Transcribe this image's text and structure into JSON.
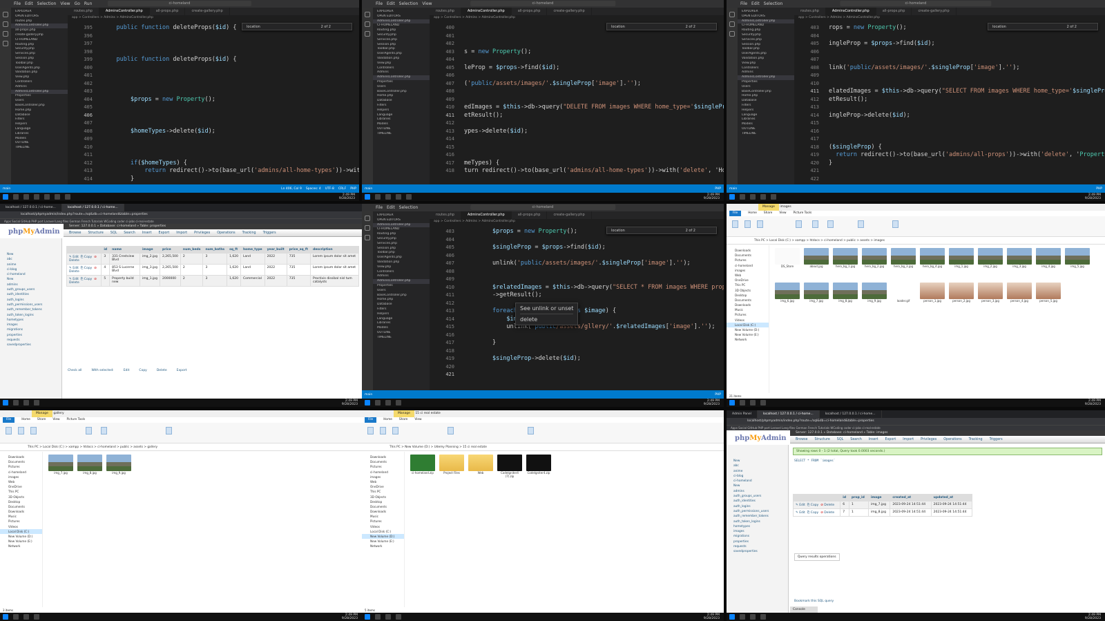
{
  "vscode": {
    "title_search": "ci-homeland",
    "menu": [
      "File",
      "Edit",
      "Selection",
      "View",
      "Go",
      "Run"
    ],
    "tabs": [
      "routes.php",
      "AdminsController.php",
      "all-props.php",
      "create-gallery.php"
    ],
    "breadcrumb": "app > Controllers > Admins > AdminsController.php",
    "find_text": "location",
    "find_count": "2 of 2",
    "explorer": [
      "EXPLORER",
      "OPEN EDITORS",
      "routes.php",
      "AdminsController.php",
      "all-props.php",
      "create-gallery.php",
      "CI-HOMELAND",
      "Routing.php",
      "Security.php",
      "Services.php",
      "Session.php",
      "Toolbar.php",
      "UserAgents.php",
      "Validation.php",
      "View.php",
      "Controllers",
      "Admins",
      "AdminsController.php",
      "Properties",
      "Users",
      "BaseController.php",
      "Home.php",
      "Database",
      "Filters",
      "Helpers",
      "Language",
      "Libraries",
      "Models",
      "OUTLINE",
      "TIMELINE"
    ],
    "status_left": "main",
    "status_right": [
      "Ln 406, Col 9",
      "Spaces: 4",
      "UTF-8",
      "CRLF",
      "PHP"
    ]
  },
  "pane1": {
    "lines": [
      {
        "n": "395",
        "t": "    public function deleteProps($id) {"
      },
      {
        "n": "396",
        "t": ""
      },
      {
        "n": "397",
        "t": ""
      },
      {
        "n": "398",
        "t": ""
      },
      {
        "n": "399",
        "t": "    public function deleteProps($id) {"
      },
      {
        "n": "400",
        "t": ""
      },
      {
        "n": "401",
        "t": ""
      },
      {
        "n": "402",
        "t": ""
      },
      {
        "n": "403",
        "t": ""
      },
      {
        "n": "404",
        "t": "        $props = new Property();"
      },
      {
        "n": "405",
        "t": ""
      },
      {
        "n": "406",
        "t": ""
      },
      {
        "n": "407",
        "t": ""
      },
      {
        "n": "408",
        "t": "        $homeTypes->delete($id);"
      },
      {
        "n": "409",
        "t": ""
      },
      {
        "n": "410",
        "t": ""
      },
      {
        "n": "411",
        "t": ""
      },
      {
        "n": "412",
        "t": "        if($homeTypes) {"
      },
      {
        "n": "413",
        "t": "            return redirect()->to(base_url('admins/all-home-types'))->with('delete',"
      },
      {
        "n": "414",
        "t": "        }"
      }
    ]
  },
  "pane2": {
    "lines": [
      {
        "n": "400",
        "t": ""
      },
      {
        "n": "401",
        "t": ""
      },
      {
        "n": "402",
        "t": ""
      },
      {
        "n": "403",
        "t": "s = new Property();"
      },
      {
        "n": "404",
        "t": ""
      },
      {
        "n": "405",
        "t": "leProp = $props->find($id);"
      },
      {
        "n": "406",
        "t": ""
      },
      {
        "n": "407",
        "t": "('public/assets/images/'.$singleProp['image'].'');"
      },
      {
        "n": "408",
        "t": ""
      },
      {
        "n": "409",
        "t": ""
      },
      {
        "n": "410",
        "t": "edImages = $this->db->query(\"DELETE FROM images WHERE home_type='$singleProps['home_t"
      },
      {
        "n": "411",
        "t": "etResult();"
      },
      {
        "n": "412",
        "t": ""
      },
      {
        "n": "413",
        "t": "ypes->delete($id);"
      },
      {
        "n": "414",
        "t": ""
      },
      {
        "n": "415",
        "t": ""
      },
      {
        "n": "416",
        "t": ""
      },
      {
        "n": "417",
        "t": "meTypes) {"
      },
      {
        "n": "418",
        "t": "turn redirect()->to(base_url('admins/all-home-types'))->with('delete', 'Home Type de"
      }
    ]
  },
  "pane3": {
    "lines": [
      {
        "n": "403",
        "t": "rops = new Property();"
      },
      {
        "n": "404",
        "t": ""
      },
      {
        "n": "405",
        "t": "ingleProp = $props->find($id);"
      },
      {
        "n": "406",
        "t": ""
      },
      {
        "n": "407",
        "t": ""
      },
      {
        "n": "408",
        "t": "link('public/assets/images/'.$singleProp['image'].'');"
      },
      {
        "n": "409",
        "t": ""
      },
      {
        "n": "410",
        "t": ""
      },
      {
        "n": "411",
        "t": "elatedImages = $this->db->query(\"SELECT FROM images WHERE home_type='$singleProps[hom"
      },
      {
        "n": "412",
        "t": "etResult();"
      },
      {
        "n": "413",
        "t": ""
      },
      {
        "n": "414",
        "t": "ingleProp->delete($id);"
      },
      {
        "n": "415",
        "t": ""
      },
      {
        "n": "416",
        "t": ""
      },
      {
        "n": "417",
        "t": ""
      },
      {
        "n": "418",
        "t": "($singleProp) {"
      },
      {
        "n": "419",
        "t": "  return redirect()->to(base_url('admins/all-props'))->with('delete', 'Property dele"
      },
      {
        "n": "420",
        "t": "}"
      },
      {
        "n": "421",
        "t": ""
      },
      {
        "n": "422",
        "t": ""
      }
    ]
  },
  "pane5": {
    "lines": [
      {
        "n": "403",
        "t": "        $props = new Property();"
      },
      {
        "n": "404",
        "t": ""
      },
      {
        "n": "405",
        "t": "        $singleProp = $props->find($id);"
      },
      {
        "n": "406",
        "t": ""
      },
      {
        "n": "407",
        "t": "        unlink('public/assets/images/'.$singleProp['image'].'');"
      },
      {
        "n": "408",
        "t": ""
      },
      {
        "n": "409",
        "t": ""
      },
      {
        "n": "410",
        "t": "        $relatedImages = $this->db->query(\"SELECT * FROM images WHERE prop_ide='$id'"
      },
      {
        "n": "411",
        "t": "        ->getResult();"
      },
      {
        "n": "412",
        "t": ""
      },
      {
        "n": "413",
        "t": "        foreach($relatedImages as $image) {"
      },
      {
        "n": "414",
        "t": "            $image->delete($id);"
      },
      {
        "n": "415",
        "t": "            unlink('public/assets/gllery/'.$relatedImages['image'].'');"
      },
      {
        "n": "416",
        "t": ""
      },
      {
        "n": "417",
        "t": "        }"
      },
      {
        "n": "418",
        "t": ""
      },
      {
        "n": "419",
        "t": "        $singleProp->delete($id);"
      },
      {
        "n": "420",
        "t": ""
      },
      {
        "n": "421",
        "t": ""
      }
    ],
    "hover1": "See unlink or unset",
    "hover2": "delete"
  },
  "taskbar": {
    "time": "2:49 PM",
    "date": "9/28/2023"
  },
  "pma1": {
    "tabs": [
      "localhost / 127.0.0.1 / ci-home...",
      "localhost / 127.0.0.1 / ci-home..."
    ],
    "url": "localhost/phpmyadmin/index.php?route=/sql&db=ci-homeland&table=properties",
    "bookmarks": "Apps  Social  GitHub  PHP  port  Laravel  Lang files  German  French  Tutorials  WCoding  coder  ci-jobs  ci-real-estate",
    "crumb": "Server: 127.0.0.1 » Database: ci-homeland » Table: properties",
    "menu": [
      "Browse",
      "Structure",
      "SQL",
      "Search",
      "Insert",
      "Export",
      "Import",
      "Privileges",
      "Operations",
      "Tracking",
      "Triggers"
    ],
    "sidebar": [
      "New",
      "abc",
      "anime",
      "ci-blog",
      "ci-homeland",
      "New",
      "admins",
      "auth_groups_users",
      "auth_identities",
      "auth_logins",
      "auth_permissions_users",
      "auth_remember_tokens",
      "auth_token_logins",
      "hometypes",
      "images",
      "migrations",
      "properties",
      "requests",
      "savedproperties"
    ],
    "columns": [
      "id",
      "name",
      "image",
      "price",
      "num_beds",
      "num_baths",
      "sq_ft",
      "home_type",
      "year_built",
      "price_sq_ft",
      "description"
    ],
    "rows": [
      [
        "3",
        "331 Crestview Blvd",
        "img_2.jpg",
        "2,265,500",
        "2",
        "3",
        "1,620",
        "Land",
        "2022",
        "735",
        "Lorem ipsum dolor sit amet"
      ],
      [
        "4",
        "853 S Lucerne Blvd",
        "img_3.jpg",
        "2,265,500",
        "2",
        "3",
        "1,620",
        "Land",
        "2022",
        "735",
        "Lorem ipsum dolor sit amet"
      ],
      [
        "5",
        "Property build new",
        "img_1.jpg",
        "2000000",
        "2",
        "3",
        "1,620",
        "Commercial",
        "2022",
        "735",
        "Proctivis dissibal nisl tum catalysts"
      ]
    ],
    "footer": [
      "Check all",
      "With selected:",
      "Edit",
      "Copy",
      "Delete",
      "Export"
    ]
  },
  "explorer_r": {
    "title": "images",
    "manage": "Manage",
    "menu": [
      "File",
      "Home",
      "Share",
      "View",
      "Picture Tools"
    ],
    "path": "This PC > Local Disk (C:) > xampp > htdocs > ci-homeland > public > assets > images",
    "nav": [
      "Downloads",
      "Documents",
      "Pictures",
      "ci-homeland",
      "images",
      "Web",
      "OneDrive",
      "This PC",
      "3D Objects",
      "Desktop",
      "Documents",
      "Downloads",
      "Music",
      "Pictures",
      "Videos",
      "Local Disk (C:)",
      "New Volume (D:)",
      "New Volume (E:)",
      "Network"
    ],
    "files": [
      "DS_Store",
      "about.jpg",
      "hero_bg_1.jpg",
      "hero_bg_2.jpg",
      "hero_bg_3.jpg",
      "hero_bg_4.jpg",
      "img_1.jpg",
      "img_2.jpg",
      "img_3.jpg",
      "img_4.jpg",
      "img_5.jpg",
      "img_6.jpg",
      "img_7.jpg",
      "img_8.jpg",
      "img_9.jpg",
      "loader.gif",
      "person_1.jpg",
      "person_2.jpg",
      "person_3.jpg",
      "person_4.jpg",
      "person_5.jpg"
    ],
    "count": "21 items"
  },
  "explorer_bl": {
    "title": "gallery",
    "manage": "Manage",
    "path": "This PC > Local Disk (C:) > xampp > htdocs > ci-homeland > public > assets > gallery",
    "files": [
      "img_7.jpg",
      "img_8.jpg",
      "img_9.jpg"
    ],
    "count": "3 items"
  },
  "explorer_bm": {
    "title": "15 ci real estate",
    "manage": "Manage",
    "path": "This PC > New Volume (D:) > Udemy Planning > 15 ci real estate",
    "files": [
      "ci-homeland.zip",
      "Project Files",
      "Web",
      "CodeIgniter4 (7).zip",
      "CodeIgniter4.zip"
    ],
    "count": "5 items"
  },
  "pma2": {
    "tabs": [
      "Admin Panel",
      "localhost / 127.0.0.1 / ci-home...",
      "localhost / 127.0.0.1 / ci-home..."
    ],
    "crumb": "Server: 127.0.0.1 » Database: ci-homeland » Table: images",
    "menu": [
      "Browse",
      "Structure",
      "SQL",
      "Search",
      "Insert",
      "Export",
      "Import",
      "Privileges",
      "Operations",
      "Tracking",
      "Triggers"
    ],
    "ok": "Showing rows 0 - 1 (2 total, Query took 0.0003 seconds.)",
    "sql": "SELECT * FROM `images`",
    "columns": [
      "id",
      "prop_id",
      "image",
      "created_at",
      "updated_at"
    ],
    "rows": [
      [
        "6",
        "1",
        "img_7.jpg",
        "2023-09-24 14:51:44",
        "2023-09-24 14:51:44"
      ],
      [
        "7",
        "1",
        "img_8.jpg",
        "2023-09-24 14:51:44",
        "2023-09-24 14:51:44"
      ]
    ],
    "ops": "Query results operations",
    "bookmark": "Bookmark this SQL query",
    "console": "Console"
  }
}
